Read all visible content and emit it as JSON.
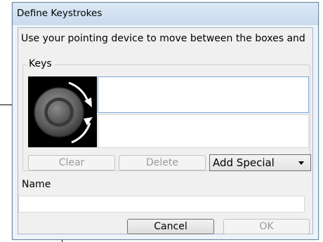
{
  "dialog": {
    "title": "Define Keystrokes",
    "instruction": "Use your pointing device to move between the boxes and",
    "keys_group_label": "Keys",
    "keystroke_boxes": [
      "",
      ""
    ],
    "buttons": {
      "clear": "Clear",
      "delete": "Delete",
      "cancel": "Cancel",
      "ok": "OK"
    },
    "add_special": {
      "selected": "Add Special"
    },
    "name_label": "Name",
    "name_value": ""
  },
  "colors": {
    "dialog_bg": "#eef3f9",
    "client_bg": "#f0f0f0",
    "focus_border": "#7aa7d6"
  },
  "icons": {
    "dial": "touch-ring-dial-icon",
    "clockwise": "clockwise-arrow-icon",
    "counterclockwise": "counterclockwise-arrow-icon",
    "dropdown": "chevron-down-icon"
  }
}
